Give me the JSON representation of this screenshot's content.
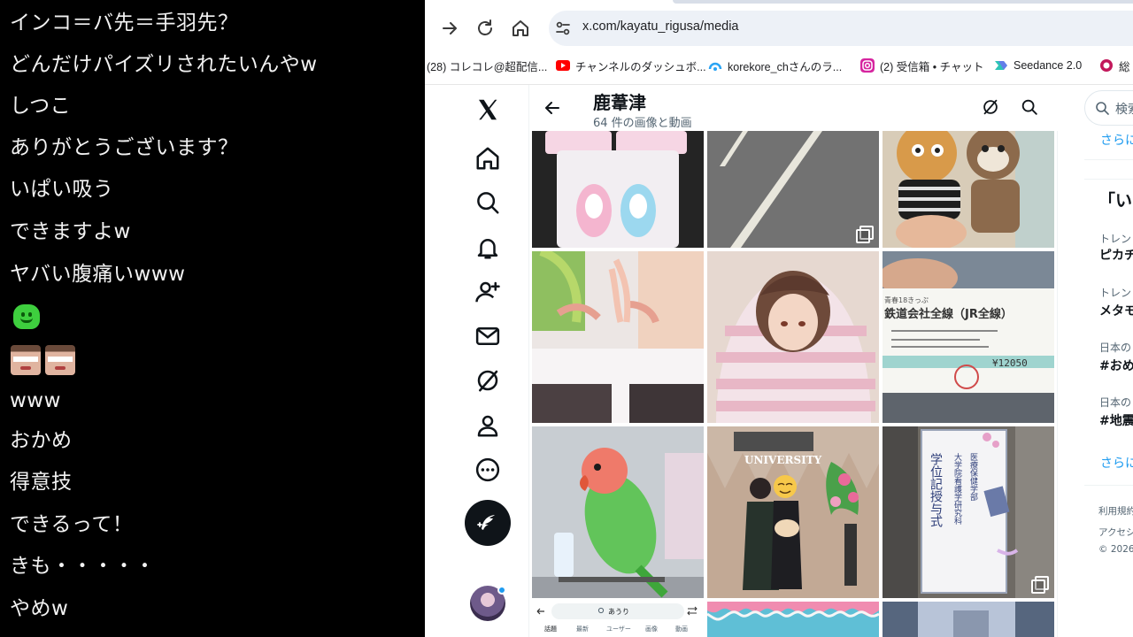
{
  "chat": {
    "messages": [
      "インコ＝バ先＝手羽先？",
      "どんだけパイズリされたいんやw",
      "しつこ",
      "ありがとうございます？",
      "いぱい吸う",
      "できますよw",
      "ヤバい腹痛いwww",
      "www",
      "おかめ",
      "得意技",
      "できるって！",
      "きも・・・・・",
      "やめw"
    ]
  },
  "browser": {
    "url": "x.com/kayatu_rigusa/media",
    "bookmarks": [
      {
        "label": "(28) コレコレ@超配信...",
        "icon_color": "#f0f0f0"
      },
      {
        "label": "チャンネルのダッシュボ...",
        "icon_color": "#ff0000"
      },
      {
        "label": "korekore_chさんのラ...",
        "icon_color": "#2aa4f4"
      },
      {
        "label": "(2) 受信箱 • チャット",
        "icon_color": "#d6249f"
      },
      {
        "label": "Seedance 2.0",
        "icon_color": "#2ec4b6"
      },
      {
        "label": "総",
        "icon_color": "#c2185b"
      }
    ]
  },
  "profile": {
    "name": "鹿葦津",
    "media_count": "64 件の画像と動画"
  },
  "grid": {
    "bottom_row_preview": {
      "search_text": "あうり",
      "tabs": [
        "話題",
        "最新",
        "ユーザー",
        "画像",
        "動画"
      ]
    }
  },
  "photo_text": {
    "university": "UNIVERSITY",
    "ceremony_sign": "学位記授与式",
    "ceremony_sub": "大学院看護学研究科",
    "ceremony_sub2": "医療保健学部",
    "ticket_line": "鉄道会社全線（JR全線）",
    "ticket_price": "¥12050",
    "ticket_head": "青春18きっぷ"
  },
  "sidebar": {
    "search_placeholder": "検索",
    "show_more_1": "さらに",
    "section_title": "「い",
    "trends": [
      {
        "context": "トレン",
        "title": "ピカチ"
      },
      {
        "context": "トレン",
        "title": "メタモ"
      },
      {
        "context": "日本の",
        "title": "#おめ"
      },
      {
        "context": "日本の",
        "title": "#地震"
      }
    ],
    "show_more_2": "さらに",
    "footer": [
      "利用規約",
      "アクセシ",
      "© 2026"
    ]
  },
  "colors": {
    "x_black": "#0f1419",
    "secondary_text": "#536471",
    "link_blue": "#1d9bf0",
    "chat_bg": "#000000",
    "chat_text": "#f2f2f2"
  }
}
